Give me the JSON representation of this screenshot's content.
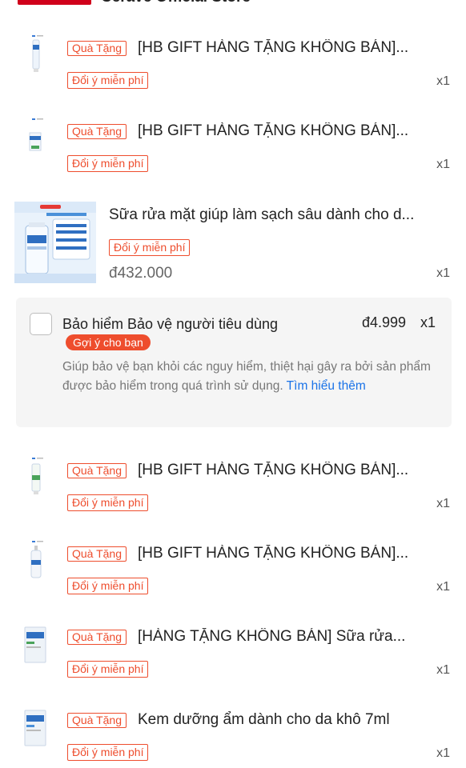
{
  "header": {
    "store_name": "Cerave Official Store"
  },
  "items": [
    {
      "gift_tag": "Quà Tặng",
      "title": "[HB GIFT HÀNG TẶNG KHÔNG BÁN]...",
      "return_badge": "Đổi ý miễn phí",
      "qty": "x1",
      "thumb_icon": "small-tube-icon"
    },
    {
      "gift_tag": "Quà Tặng",
      "title": "[HB GIFT HÀNG TẶNG KHÔNG BÁN]...",
      "return_badge": "Đổi ý miễn phí",
      "qty": "x1",
      "thumb_icon": "small-box-icon"
    },
    {
      "title": "Sữa rửa mặt giúp làm sạch sâu dành cho d...",
      "return_badge": "Đổi ý miễn phí",
      "price": "đ432.000",
      "qty": "x1",
      "thumb_icon": "cleanser-bottle-image"
    },
    {
      "gift_tag": "Quà Tặng",
      "title": "[HB GIFT HÀNG TẶNG KHÔNG BÁN]...",
      "return_badge": "Đổi ý miễn phí",
      "qty": "x1",
      "thumb_icon": "small-tube-icon"
    },
    {
      "gift_tag": "Quà Tặng",
      "title": "[HB GIFT HÀNG TẶNG KHÔNG BÁN]...",
      "return_badge": "Đổi ý miễn phí",
      "qty": "x1",
      "thumb_icon": "small-pump-bottle-icon"
    },
    {
      "gift_tag": "Quà Tặng",
      "title": "[HÀNG TẶNG KHÔNG BÁN] Sữa rửa...",
      "return_badge": "Đổi ý miễn phí",
      "qty": "x1",
      "thumb_icon": "sachet-icon"
    },
    {
      "gift_tag": "Quà Tặng",
      "title": "Kem dưỡng ẩm dành cho da khô 7ml",
      "return_badge": "Đổi ý miễn phí",
      "qty": "x1",
      "thumb_icon": "sachet-icon"
    }
  ],
  "insurance": {
    "title": "Bảo hiểm Bảo vệ người tiêu dùng",
    "badge": "Gợi ý cho bạn",
    "price": "đ4.999",
    "qty": "x1",
    "description": "Giúp bảo vệ bạn khỏi các nguy hiểm, thiệt hại gây ra bởi sản phẩm được bảo hiểm trong quá trình sử dụng.",
    "link": "Tìm hiểu thêm"
  },
  "colors": {
    "accent": "#ee4d2d",
    "mall": "#d0011b",
    "link": "#1a73e8",
    "panel": "#f5f5f5"
  }
}
